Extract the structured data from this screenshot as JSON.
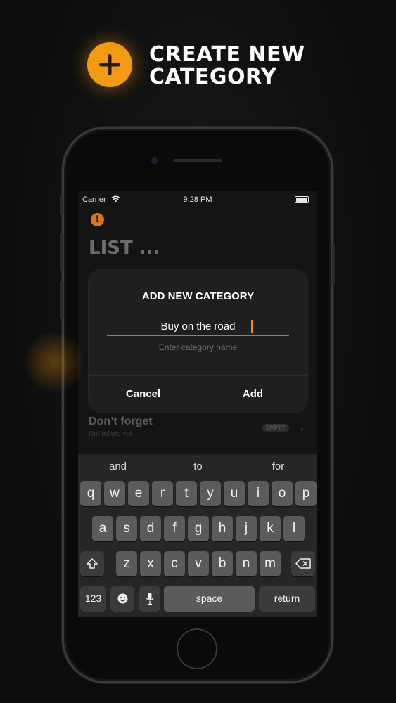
{
  "promo": {
    "title_line1": "CREATE NEW",
    "title_line2": "CATEGORY",
    "icon": "plus-icon",
    "accent_color": "#f39a12"
  },
  "status_bar": {
    "carrier": "Carrier",
    "time": "9:28 PM"
  },
  "app": {
    "list_title": "LIST ..."
  },
  "dialog": {
    "title": "ADD NEW CATEGORY",
    "input_value": "Buy on the road",
    "hint": "Enter category name",
    "cancel_label": "Cancel",
    "add_label": "Add"
  },
  "list_row": {
    "title": "Don’t forget",
    "subtitle": "Not edited yet",
    "badge": "EMPTY"
  },
  "keyboard": {
    "suggestions": [
      "and",
      "to",
      "for"
    ],
    "row1": [
      "q",
      "w",
      "e",
      "r",
      "t",
      "y",
      "u",
      "i",
      "o",
      "p"
    ],
    "row2": [
      "a",
      "s",
      "d",
      "f",
      "g",
      "h",
      "j",
      "k",
      "l"
    ],
    "row3": [
      "z",
      "x",
      "c",
      "v",
      "b",
      "n",
      "m"
    ],
    "numbers_label": "123",
    "space_label": "space",
    "return_label": "return"
  }
}
